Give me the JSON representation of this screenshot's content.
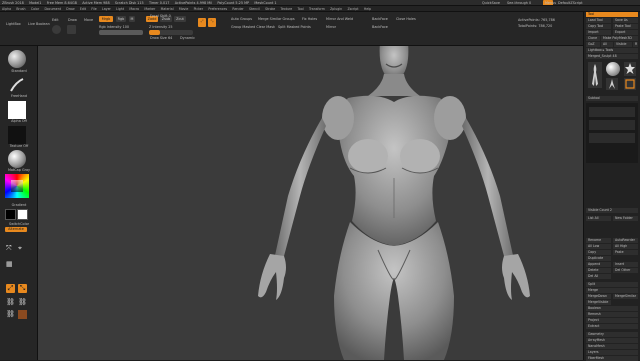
{
  "titlebar": {
    "items": [
      "ZBrush 2018",
      "Model1",
      "Free Mem 8.64GB",
      "Active Mem 988",
      "Scratch Disk 115",
      "Timer 0.017",
      "ActivePoints 4.998 Mil",
      "PolyCount 5.25 MP",
      "MeshCount 1"
    ],
    "right_items": [
      "QuickSave",
      "See-through 0",
      "Menus",
      "DefaultZScript"
    ]
  },
  "menubar": {
    "items": [
      "Alpha",
      "Brush",
      "Color",
      "Document",
      "Draw",
      "Edit",
      "File",
      "Layer",
      "Light",
      "Macro",
      "Marker",
      "Material",
      "Movie",
      "Picker",
      "Preferences",
      "Render",
      "Stencil",
      "Stroke",
      "Texture",
      "Tool",
      "Transform",
      "Zplugin",
      "Zscript",
      "Help"
    ]
  },
  "toolbar": {
    "lightbox": "LightBox",
    "live_boolean": "Live Boolean",
    "edit": "Edit",
    "draw": "Draw",
    "move": "Move",
    "scale": "Scale",
    "rotate": "Rotate",
    "mrgb": "Mrgb",
    "rgb": "Rgb",
    "m": "M",
    "zadd": "Zadd",
    "zsub": "Zsub",
    "zcut": "Zcut",
    "focal_shift": "Focal Shift 0",
    "draw_size": "Draw Size 64",
    "dynamic": "Dynamic",
    "rgb_intensity": "Rgb Intensity 100",
    "z_intensity": "Z Intensity 25",
    "auto_groups": "Auto Groups",
    "merge_similar_groups": "Merge Similar Groups",
    "group_masked_clear_mask": "Group Masked Clear Mask",
    "split_masked_points": "Split Masked Points",
    "fix_holes": "Fix Holes",
    "mirror": "Mirror",
    "mirror_and_weld": "Mirror And Weld",
    "backface": "BackFace",
    "close_holes": "Close Holes",
    "active_points": "ActivePoints: 765,786",
    "total_points": "TotalPoints: 786,720"
  },
  "leftshelf": {
    "brush": "Standard",
    "stroke": "FreeHand",
    "alpha": "Alpha Off",
    "texture": "Texture Off",
    "material": "MatCap Gray",
    "gradient": "Gradient",
    "switch_color": "SwitchColor",
    "alternate": "Alternate"
  },
  "rightshelf": {
    "tool_label": "Tool",
    "load_tool": "Load Tool",
    "save_as": "Save As",
    "copy_tool": "Copy Tool",
    "paste_tool": "Paste Tool",
    "import": "Import",
    "export": "Export",
    "clone": "Clone",
    "make_polymesh3d": "Make PolyMesh3D",
    "goz": "GoZ",
    "all": "All",
    "visible": "Visible",
    "r": "R",
    "lightbox_tools": "Lightbox ▸ Tools",
    "current_tool": "Merged_Sculpt 48",
    "subtool": "Subtool",
    "visible_count": "Visible Count 2",
    "list_all": "List All",
    "new_folder": "New Folder",
    "rename": "Rename",
    "auto_reorder": "AutoReorder",
    "all_low": "All Low",
    "all_high": "All High",
    "copy": "Copy",
    "paste": "Paste",
    "duplicate": "Duplicate",
    "append": "Append",
    "insert": "Insert",
    "delete": "Delete",
    "del_other": "Del Other",
    "del_all": "Del All",
    "split": "Split",
    "merge": "Merge",
    "merge_down": "MergeDown",
    "merge_similar": "MergeSimilar",
    "merge_visible": "MergeVisible",
    "boolean": "Boolean",
    "remesh": "Remesh",
    "project": "Project",
    "extract": "Extract",
    "geometry": "Geometry",
    "array_mesh": "ArrayMesh",
    "nano_mesh": "NanoMesh",
    "layers": "Layers",
    "fibermesh": "FiberMesh"
  },
  "colors": {
    "accent": "#e8891e",
    "canvas": "#3b3b3b",
    "panel": "#262626"
  }
}
